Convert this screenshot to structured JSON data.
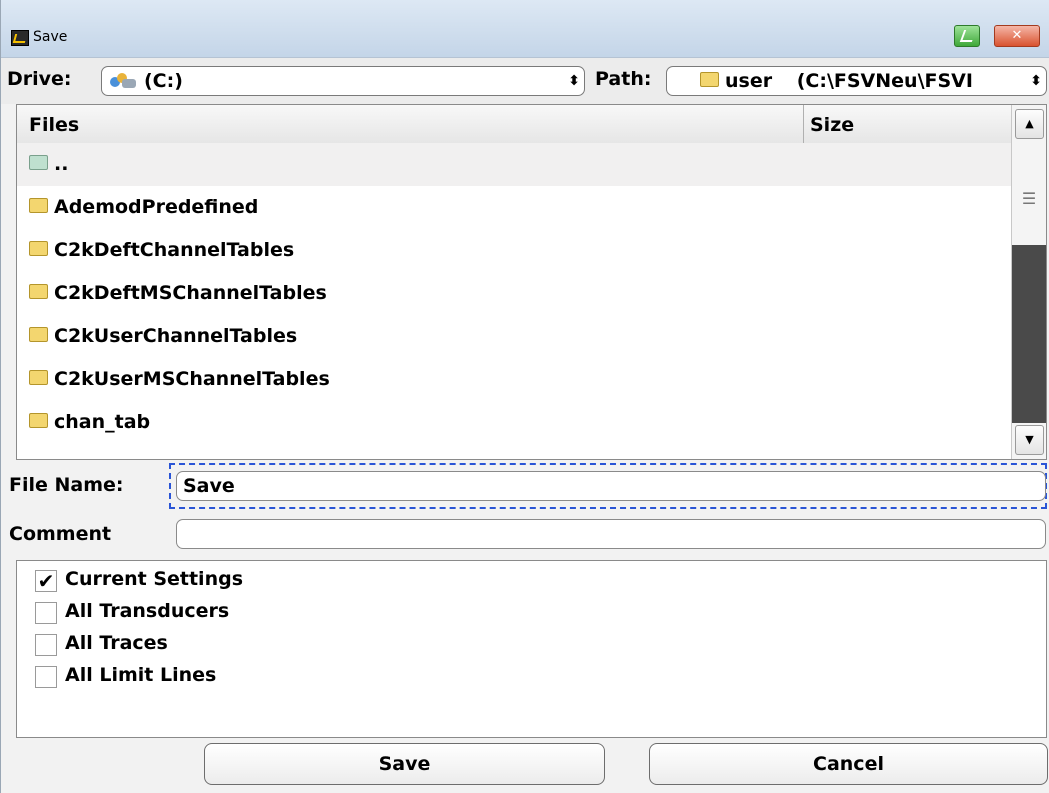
{
  "window": {
    "title": "Save"
  },
  "drive": {
    "label": "Drive:",
    "value": "(C:)"
  },
  "path": {
    "label": "Path:",
    "folder": "user",
    "value": "(C:\\FSVNeu\\FSVI"
  },
  "file_list": {
    "columns": {
      "files": "Files",
      "size": "Size"
    },
    "rows": [
      {
        "name": "..",
        "size": ""
      },
      {
        "name": "AdemodPredefined",
        "size": ""
      },
      {
        "name": "C2kDeftChannelTables",
        "size": ""
      },
      {
        "name": "C2kDeftMSChannelTables",
        "size": ""
      },
      {
        "name": "C2kUserChannelTables",
        "size": ""
      },
      {
        "name": "C2kUserMSChannelTables",
        "size": ""
      },
      {
        "name": "chan_tab",
        "size": ""
      }
    ]
  },
  "file_name": {
    "label": "File Name:",
    "value": "Save"
  },
  "comment": {
    "label": "Comment",
    "value": ""
  },
  "options": [
    {
      "label": "Current Settings",
      "checked": true
    },
    {
      "label": "All Transducers",
      "checked": false
    },
    {
      "label": "All Traces",
      "checked": false
    },
    {
      "label": "All Limit Lines",
      "checked": false
    }
  ],
  "buttons": {
    "save": "Save",
    "cancel": "Cancel"
  },
  "icons": {
    "app": "analyzer-app-icon",
    "edit": "edit-icon",
    "close": "close-icon",
    "drive": "drive-icon",
    "folder": "folder-icon",
    "scroll_up": "arrow-up-icon",
    "scroll_down": "arrow-down-icon",
    "checkmark": "checkmark-icon"
  },
  "colors": {
    "focus": "#2a55d6",
    "close_button": "#d9532f",
    "edit_button": "#3fa83a"
  }
}
